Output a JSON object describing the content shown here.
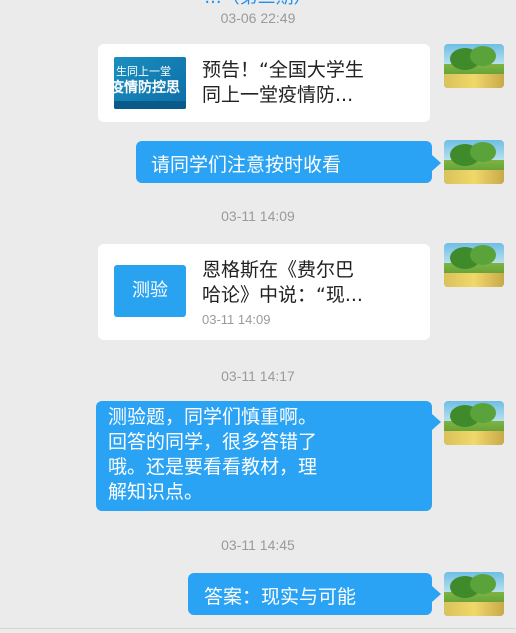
{
  "header": {
    "title_partial": "...（第三期）"
  },
  "messages": [
    {
      "type": "timestamp",
      "text": "03-06 22:49"
    },
    {
      "type": "link-card",
      "thumb_line1": "生同上一堂",
      "thumb_line2": "疫情防控思",
      "title_line1": "预告！“全国大学生",
      "title_line2": "同上一堂疫情防..."
    },
    {
      "type": "text",
      "text": "请同学们注意按时收看"
    },
    {
      "type": "timestamp",
      "text": "03-11 14:09"
    },
    {
      "type": "quiz-card",
      "icon_label": "测验",
      "title_line1": "恩格斯在《费尔巴",
      "title_line2": "哈论》中说：“现...",
      "time": "03-11 14:09"
    },
    {
      "type": "timestamp",
      "text": "03-11 14:17"
    },
    {
      "type": "text-multiline",
      "lines": [
        "测验题，同学们慎重啊。",
        "回答的同学，很多答错了",
        "哦。还是要看看教材，理",
        "解知识点。"
      ]
    },
    {
      "type": "timestamp",
      "text": "03-11 14:45"
    },
    {
      "type": "text",
      "text": "答案：现实与可能"
    }
  ],
  "colors": {
    "bubble": "#2aa3f5",
    "background": "#ebebeb",
    "timestamp": "#9a9a9a"
  },
  "icons": {
    "avatar": "landscape-avatar-icon"
  }
}
